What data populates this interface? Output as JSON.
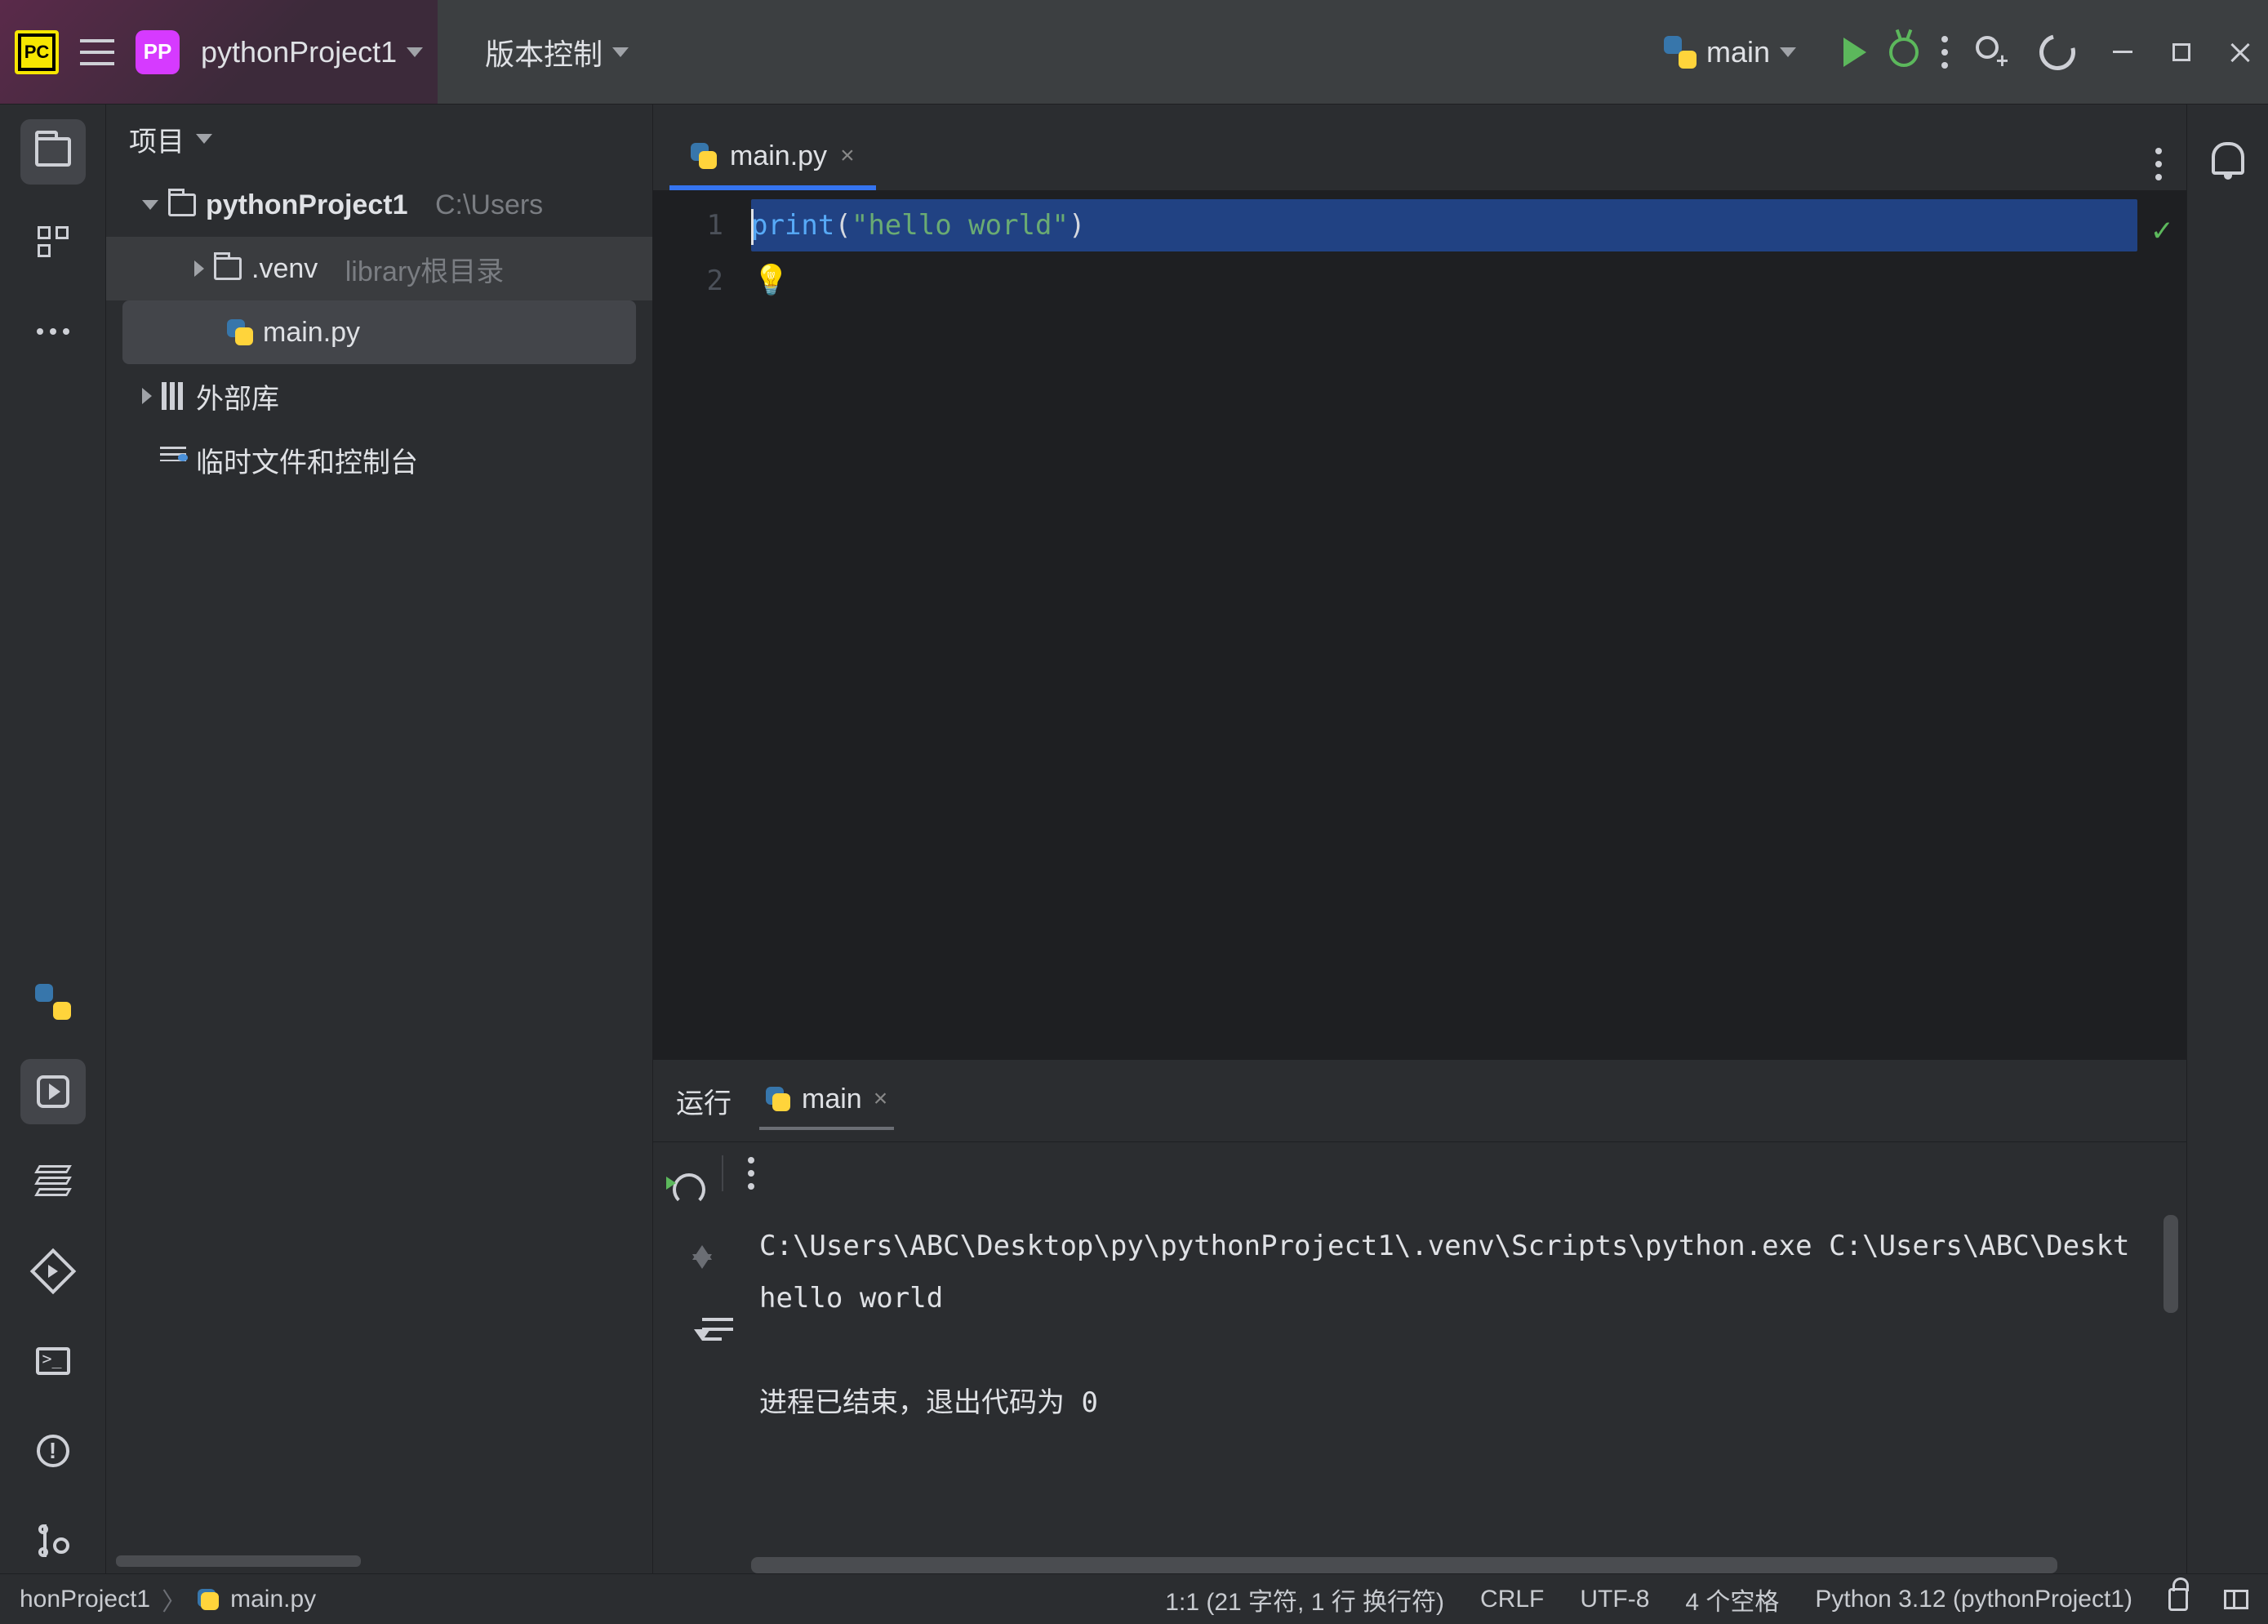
{
  "titlebar": {
    "app_badge": "PC",
    "project_badge": "PP",
    "project_name": "pythonProject1",
    "vcs_label": "版本控制",
    "run_config": "main"
  },
  "project_panel": {
    "title": "项目",
    "root": {
      "name": "pythonProject1",
      "path": "C:\\Users"
    },
    "venv": {
      "name": ".venv",
      "hint": "library根目录"
    },
    "file": "main.py",
    "external": "外部库",
    "scratches": "临时文件和控制台"
  },
  "editor": {
    "tab": "main.py",
    "lines": [
      "1",
      "2"
    ],
    "code": {
      "fn": "print",
      "open": "(",
      "str": "\"hello world\"",
      "close": ")"
    },
    "bulb": "💡"
  },
  "run_panel": {
    "title": "运行",
    "tab": "main",
    "output_line1": "C:\\Users\\ABC\\Desktop\\py\\pythonProject1\\.venv\\Scripts\\python.exe C:\\Users\\ABC\\Deskt",
    "output_line2": "hello world",
    "exit_line": "进程已结束，退出代码为 0"
  },
  "statusbar": {
    "crumb_project": "honProject1",
    "crumb_file": "main.py",
    "caret": "1:1 (21 字符, 1 行 换行符)",
    "eol": "CRLF",
    "encoding": "UTF-8",
    "indent": "4 个空格",
    "interpreter": "Python 3.12 (pythonProject1)"
  }
}
